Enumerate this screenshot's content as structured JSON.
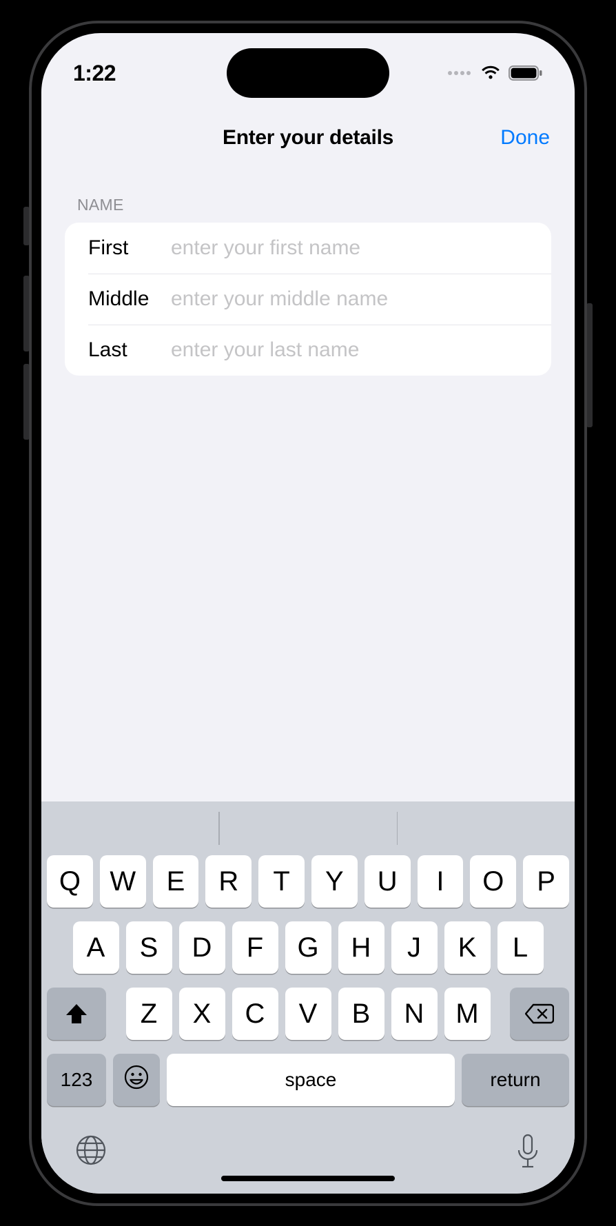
{
  "status": {
    "time": "1:22"
  },
  "nav": {
    "title": "Enter your details",
    "done": "Done"
  },
  "section": {
    "header": "Name"
  },
  "form": {
    "first": {
      "label": "First",
      "placeholder": "enter your first name",
      "value": ""
    },
    "middle": {
      "label": "Middle",
      "placeholder": "enter your middle name",
      "value": ""
    },
    "last": {
      "label": "Last",
      "placeholder": "enter your last name",
      "value": ""
    }
  },
  "keyboard": {
    "row1": [
      "Q",
      "W",
      "E",
      "R",
      "T",
      "Y",
      "U",
      "I",
      "O",
      "P"
    ],
    "row2": [
      "A",
      "S",
      "D",
      "F",
      "G",
      "H",
      "J",
      "K",
      "L"
    ],
    "row3": [
      "Z",
      "X",
      "C",
      "V",
      "B",
      "N",
      "M"
    ],
    "num": "123",
    "space": "space",
    "ret": "return"
  }
}
